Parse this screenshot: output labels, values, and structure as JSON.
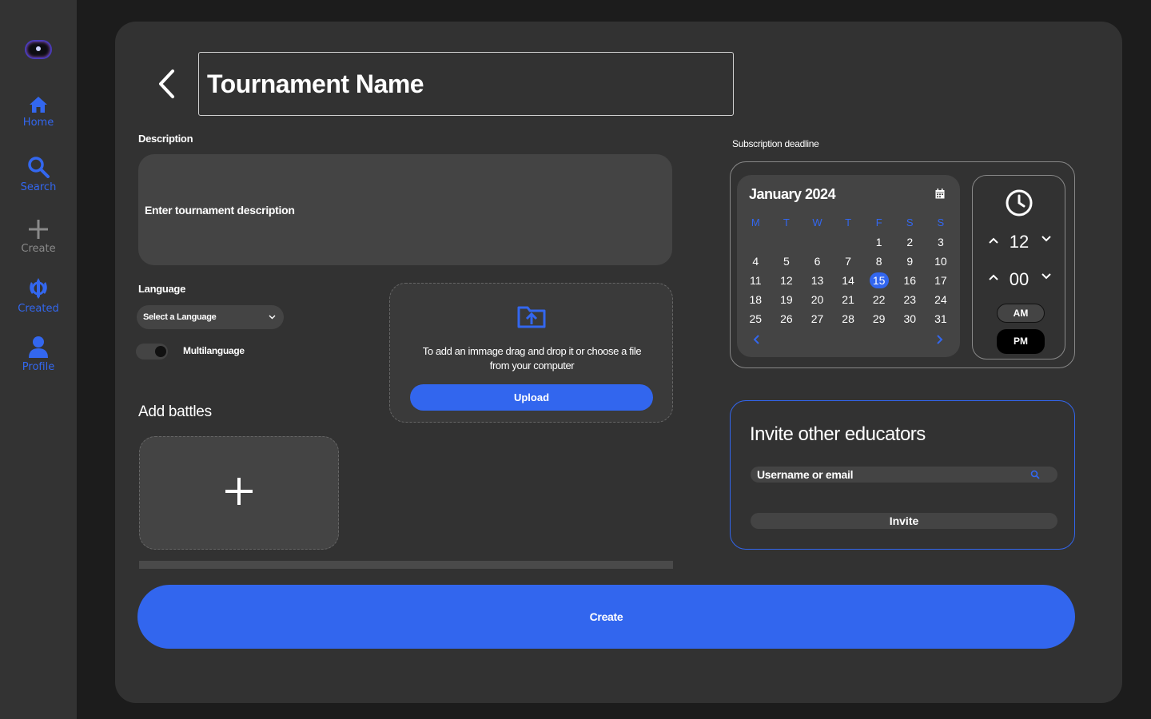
{
  "sidebar": {
    "items": [
      {
        "label": "Home",
        "icon": "home-icon",
        "color": "#3367ef"
      },
      {
        "label": "Search",
        "icon": "search-icon",
        "color": "#3367ef"
      },
      {
        "label": "Create",
        "icon": "plus-icon",
        "color": "#8a8a8a"
      },
      {
        "label": "Created",
        "icon": "khanda-icon",
        "color": "#3367ef"
      },
      {
        "label": "Profile",
        "icon": "user-icon",
        "color": "#3367ef"
      }
    ]
  },
  "header": {
    "title_value": "Tournament Name"
  },
  "description": {
    "label": "Description",
    "placeholder": "Enter tournament description"
  },
  "language": {
    "label": "Language",
    "select_value": "Select a Language",
    "multilanguage_label": "Multilanguage"
  },
  "upload": {
    "text": "To add an immage drag and drop it or choose a file from your computer",
    "button_label": "Upload"
  },
  "battles": {
    "title": "Add battles"
  },
  "deadline": {
    "label": "Subscription deadline",
    "calendar": {
      "month_title": "January 2024",
      "day_headers": [
        "M",
        "T",
        "W",
        "T",
        "F",
        "S",
        "S"
      ],
      "leading_blanks": 4,
      "days": [
        "1",
        "2",
        "3",
        "4",
        "5",
        "6",
        "7",
        "8",
        "9",
        "10",
        "11",
        "12",
        "13",
        "14",
        "15",
        "16",
        "17",
        "18",
        "19",
        "20",
        "21",
        "22",
        "23",
        "24",
        "25",
        "26",
        "27",
        "28",
        "29",
        "30",
        "31"
      ],
      "selected_day": "15"
    },
    "time": {
      "hour": "12",
      "minute": "00",
      "am_label": "AM",
      "pm_label": "PM",
      "selected_period": "PM"
    }
  },
  "invite": {
    "title": "Invite other educators",
    "input_placeholder": "Username or email",
    "button_label": "Invite"
  },
  "create_button_label": "Create",
  "colors": {
    "accent": "#3266ee",
    "panel": "#323232",
    "sidebar": "#333333",
    "field": "#444444"
  }
}
